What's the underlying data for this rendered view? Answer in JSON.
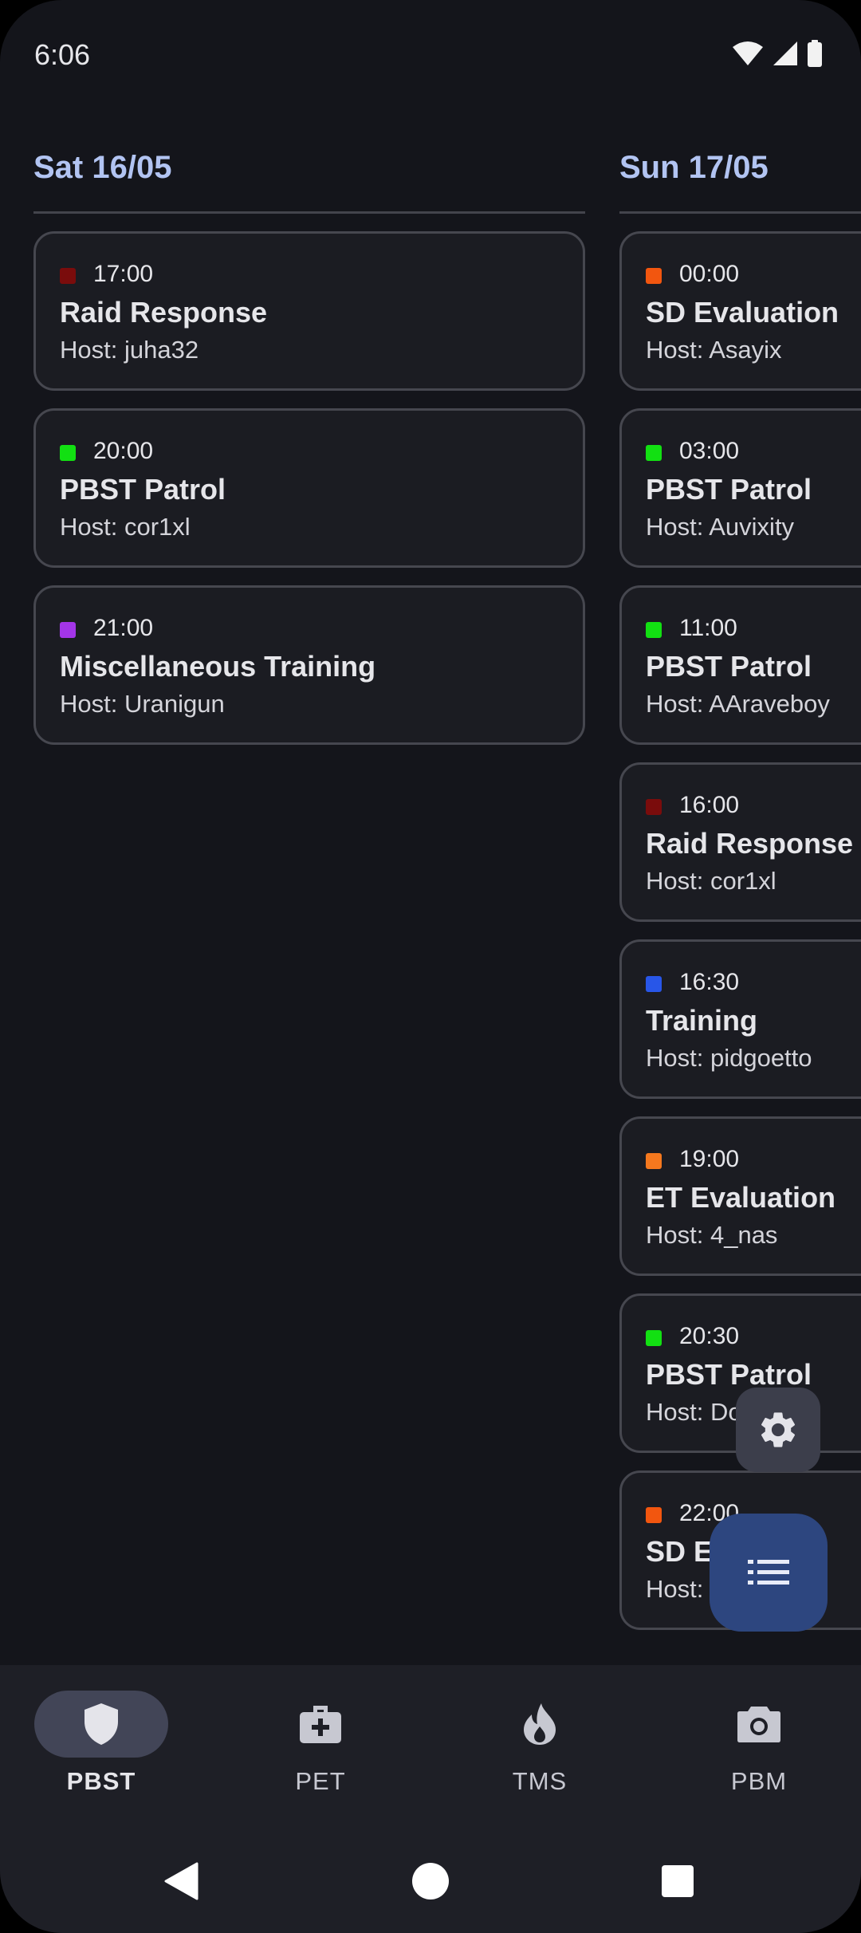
{
  "status_bar": {
    "time": "6:06"
  },
  "days": [
    {
      "title": "Sat 16/05",
      "events": [
        {
          "time": "17:00",
          "title": "Raid Response",
          "host": "Host: juha32",
          "color": "#7a0c0c"
        },
        {
          "time": "20:00",
          "title": "PBST Patrol",
          "host": "Host: cor1xl",
          "color": "#12e012"
        },
        {
          "time": "21:00",
          "title": "Miscellaneous Training",
          "host": "Host: Uranigun",
          "color": "#a335e8"
        }
      ]
    },
    {
      "title": "Sun 17/05",
      "events": [
        {
          "time": "00:00",
          "title": "SD Evaluation",
          "host": "Host: Asayix",
          "color": "#f2560f"
        },
        {
          "time": "03:00",
          "title": "PBST Patrol",
          "host": "Host: Auvixity",
          "color": "#12e012"
        },
        {
          "time": "11:00",
          "title": "PBST Patrol",
          "host": "Host: AAraveboy",
          "color": "#12e012"
        },
        {
          "time": "16:00",
          "title": "Raid Response",
          "host": "Host: cor1xl",
          "color": "#7a0c0c"
        },
        {
          "time": "16:30",
          "title": "Training",
          "host": "Host: pidgoetto",
          "color": "#2856e8"
        },
        {
          "time": "19:00",
          "title": "ET Evaluation",
          "host": "Host: 4_nas",
          "color": "#f5781e"
        },
        {
          "time": "20:30",
          "title": "PBST Patrol",
          "host": "Host: Do      ch",
          "color": "#12e012"
        },
        {
          "time": "22:00",
          "title": "SD Ev",
          "host": "Host:          39",
          "color": "#f2560f"
        }
      ]
    }
  ],
  "fabs": {
    "settings_icon": "gear-icon",
    "list_icon": "list-icon"
  },
  "bottom_nav": {
    "items": [
      {
        "label": "PBST",
        "icon": "shield-icon",
        "active": true
      },
      {
        "label": "PET",
        "icon": "medkit-icon",
        "active": false
      },
      {
        "label": "TMS",
        "icon": "fire-icon",
        "active": false
      },
      {
        "label": "PBM",
        "icon": "camera-icon",
        "active": false
      }
    ]
  },
  "colors": {
    "background": "#14151b",
    "day_title": "#b2c4f2",
    "card_bg": "#1b1c22",
    "card_border": "#46474f",
    "fab_primary": "#2d467f",
    "nav_active_pill": "#424557"
  }
}
